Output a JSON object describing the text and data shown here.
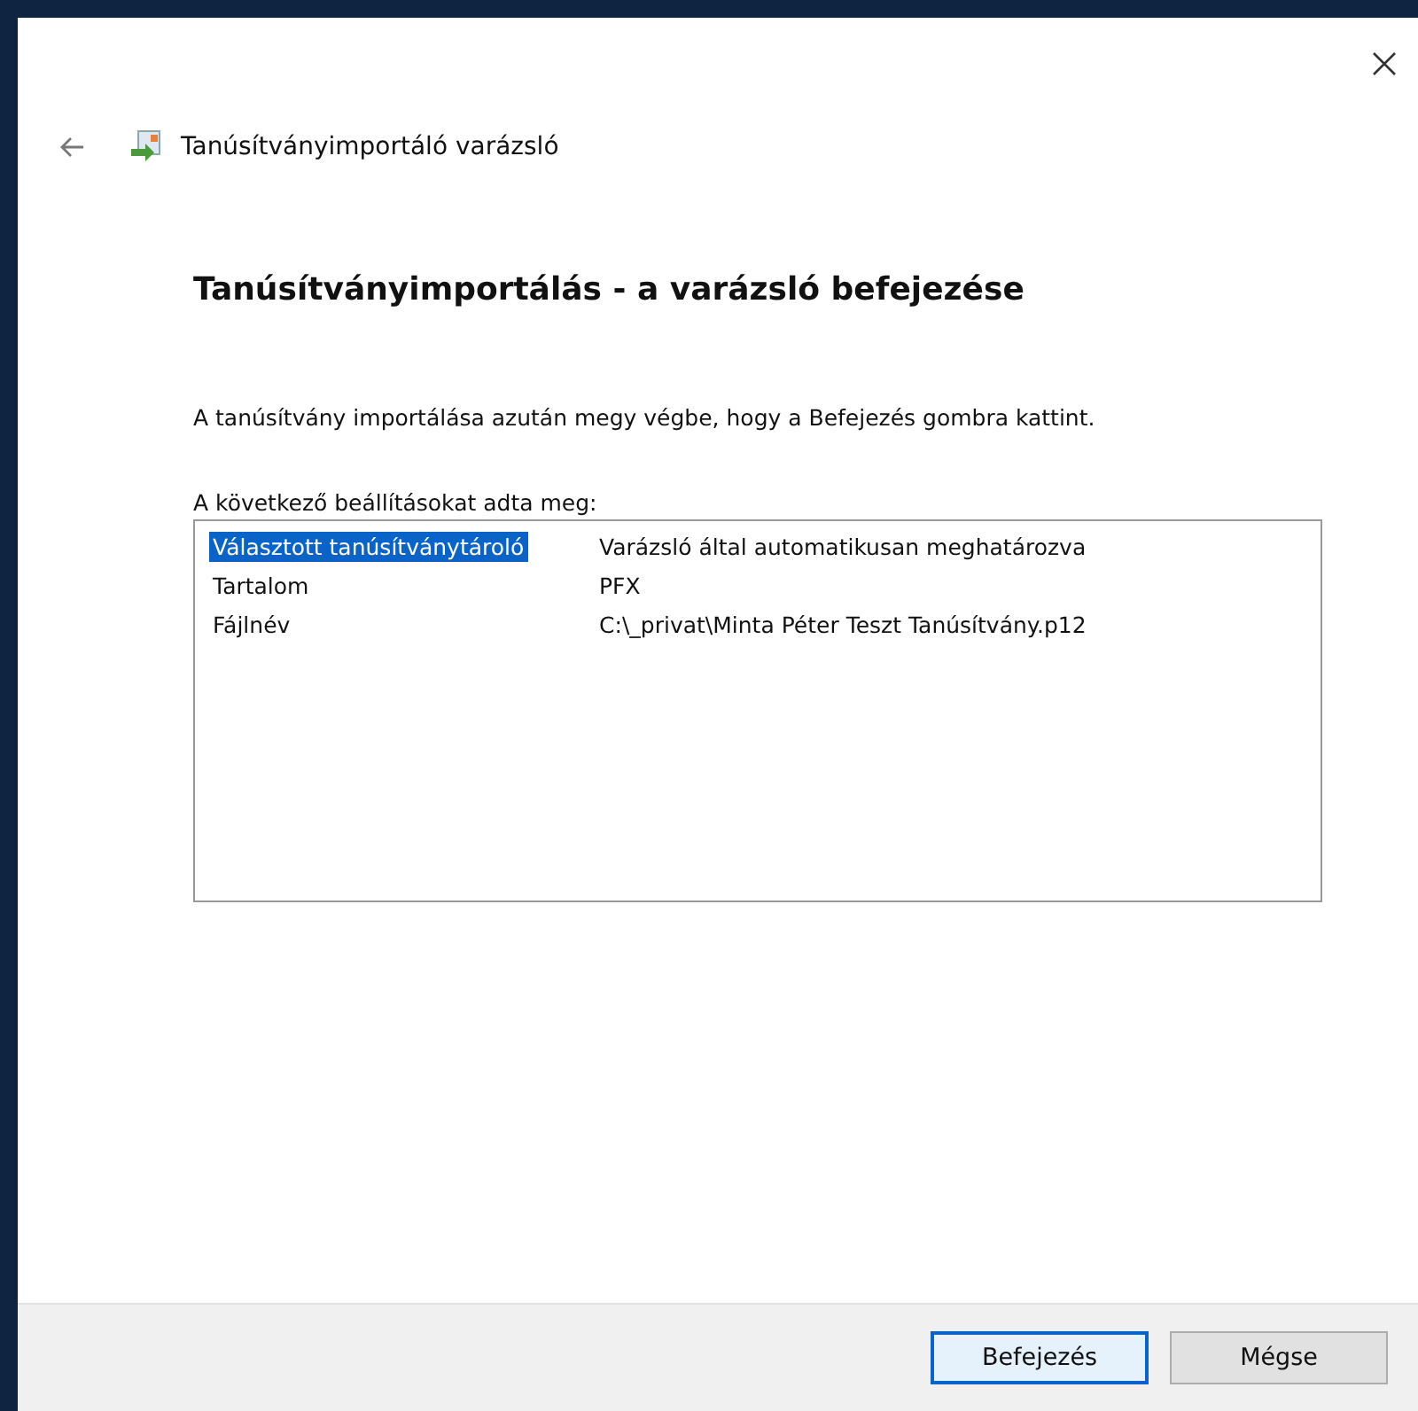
{
  "window": {
    "title": "Tanúsítványimportáló varázsló"
  },
  "heading": "Tanúsítványimportálás - a varázsló befejezése",
  "description": "A tanúsítvány importálása azután megy végbe, hogy a Befejezés gombra kattint.",
  "settings_label": "A következő beállításokat adta meg:",
  "settings": [
    {
      "name": "Választott tanúsítványtároló",
      "value": "Varázsló által automatikusan meghatározva",
      "selected": true
    },
    {
      "name": "Tartalom",
      "value": "PFX",
      "selected": false
    },
    {
      "name": "Fájlnév",
      "value": "C:\\_privat\\Minta Péter Teszt Tanúsítvány.p12",
      "selected": false
    }
  ],
  "buttons": [
    {
      "label": "Befejezés",
      "default": true
    },
    {
      "label": "Mégse",
      "default": false
    }
  ]
}
